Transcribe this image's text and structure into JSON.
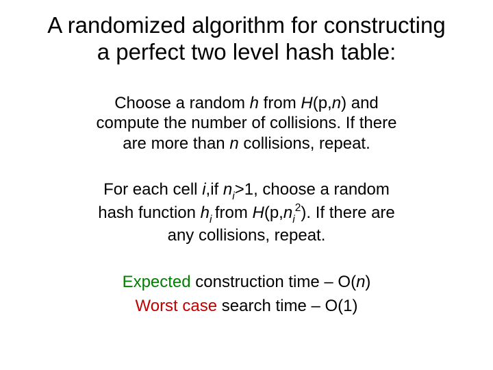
{
  "title": {
    "line1": "A randomized algorithm for constructing",
    "line2": "a perfect two level hash table:"
  },
  "para1": {
    "seg1": "Choose a random ",
    "h": "h",
    "seg2": " from ",
    "H": "H",
    "seg3": "(p,",
    "n1": "n",
    "seg4": ") and",
    "seg5": "compute the number of collisions. If there",
    "seg6": "are more than ",
    "n2": "n",
    "seg7": " collisions, repeat."
  },
  "para2": {
    "seg1": "For each cell ",
    "i": "i",
    "seg2": ",if ",
    "nsub": "n",
    "isub1": "i",
    "seg3": ">1, choose a random",
    "seg4": "hash function ",
    "hsub": "h",
    "isub2": "i ",
    "seg5": "from ",
    "H": "H",
    "seg6": "(p,",
    "n2": "n",
    "isub3": "i",
    "sq": "2",
    "seg7": "). If there are",
    "seg8": "any collisions, repeat."
  },
  "para3": {
    "e1a": "Expected",
    "e1b": " construction time – O(",
    "e1n": "n",
    "e1c": ")",
    "e2a": "Worst case",
    "e2b": " search time – O(1)"
  }
}
